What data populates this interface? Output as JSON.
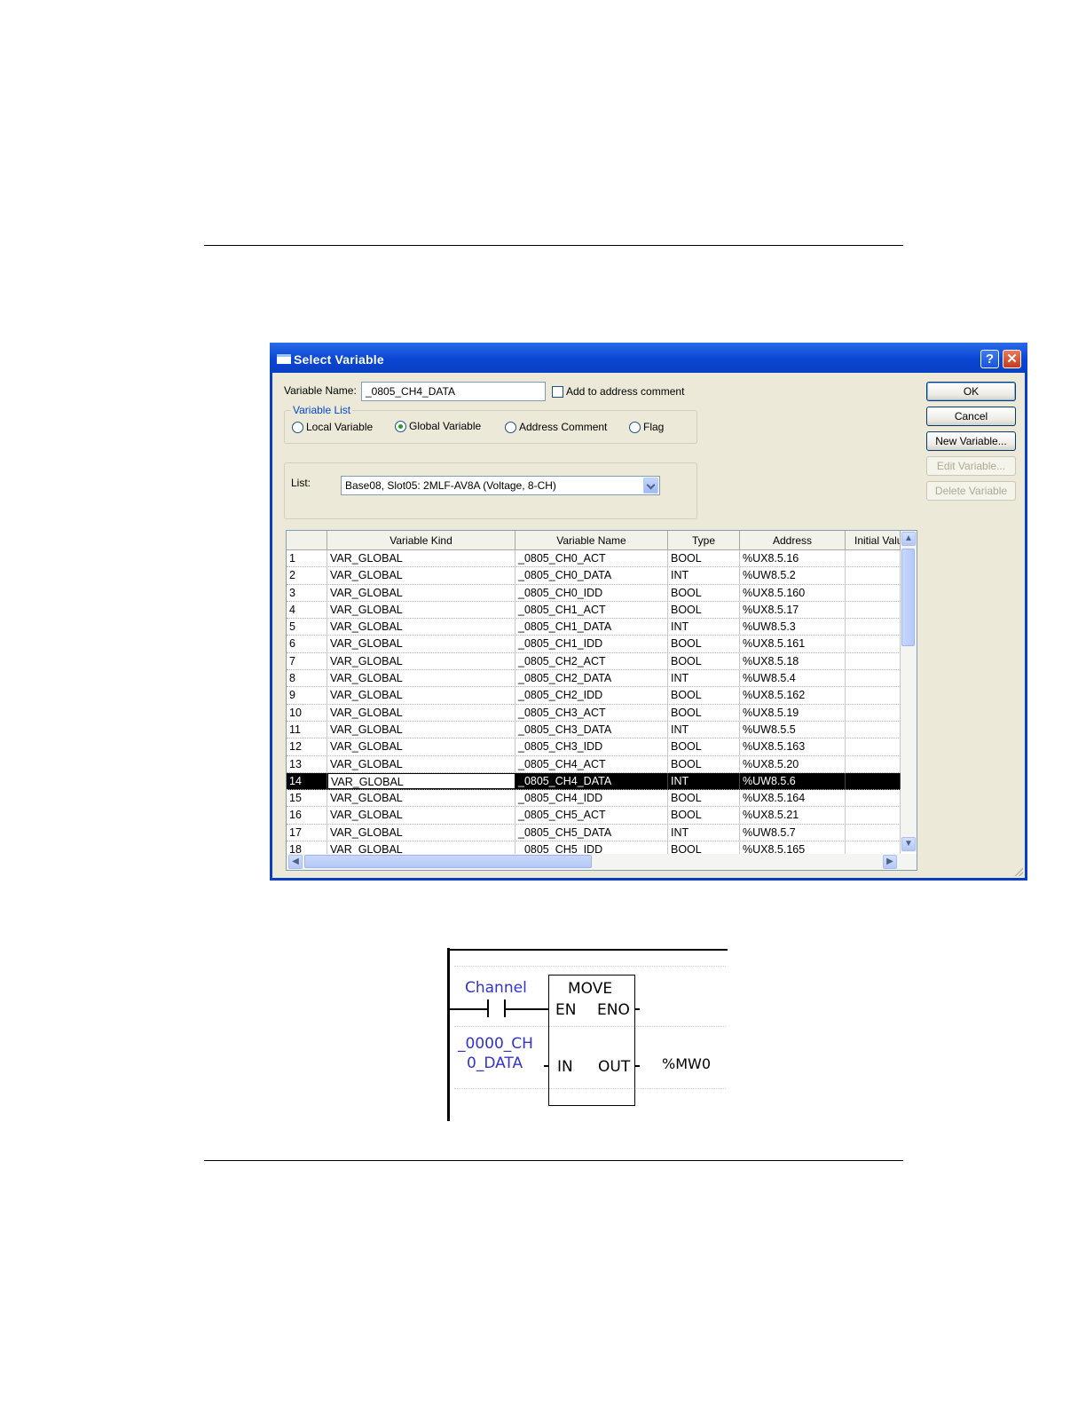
{
  "dialog": {
    "title": "Select Variable",
    "help_label": "?",
    "close_label": "✕",
    "variable_name_label": "Variable Name:",
    "variable_name_value": "_0805_CH4_DATA",
    "add_comment_label": "Add to address comment",
    "add_comment_checked": false,
    "variable_list_label": "Variable List",
    "radios": {
      "local": "Local Variable",
      "global": "Global Variable",
      "address_comment": "Address Comment",
      "flag": "Flag",
      "selected": "global"
    },
    "list_label": "List:",
    "list_value": "Base08, Slot05:  2MLF-AV8A (Voltage, 8-CH)",
    "buttons": {
      "ok": "OK",
      "cancel": "Cancel",
      "new_variable": "New Variable...",
      "edit_variable": "Edit Variable...",
      "delete_variable": "Delete Variable"
    },
    "table": {
      "columns": [
        "",
        "Variable Kind",
        "Variable Name",
        "Type",
        "Address",
        "Initial Valu"
      ],
      "selected_row": 14,
      "rows": [
        [
          "1",
          "VAR_GLOBAL",
          "_0805_CH0_ACT",
          "BOOL",
          "%UX8.5.16",
          ""
        ],
        [
          "2",
          "VAR_GLOBAL",
          "_0805_CH0_DATA",
          "INT",
          "%UW8.5.2",
          ""
        ],
        [
          "3",
          "VAR_GLOBAL",
          "_0805_CH0_IDD",
          "BOOL",
          "%UX8.5.160",
          ""
        ],
        [
          "4",
          "VAR_GLOBAL",
          "_0805_CH1_ACT",
          "BOOL",
          "%UX8.5.17",
          ""
        ],
        [
          "5",
          "VAR_GLOBAL",
          "_0805_CH1_DATA",
          "INT",
          "%UW8.5.3",
          ""
        ],
        [
          "6",
          "VAR_GLOBAL",
          "_0805_CH1_IDD",
          "BOOL",
          "%UX8.5.161",
          ""
        ],
        [
          "7",
          "VAR_GLOBAL",
          "_0805_CH2_ACT",
          "BOOL",
          "%UX8.5.18",
          ""
        ],
        [
          "8",
          "VAR_GLOBAL",
          "_0805_CH2_DATA",
          "INT",
          "%UW8.5.4",
          ""
        ],
        [
          "9",
          "VAR_GLOBAL",
          "_0805_CH2_IDD",
          "BOOL",
          "%UX8.5.162",
          ""
        ],
        [
          "10",
          "VAR_GLOBAL",
          "_0805_CH3_ACT",
          "BOOL",
          "%UX8.5.19",
          ""
        ],
        [
          "11",
          "VAR_GLOBAL",
          "_0805_CH3_DATA",
          "INT",
          "%UW8.5.5",
          ""
        ],
        [
          "12",
          "VAR_GLOBAL",
          "_0805_CH3_IDD",
          "BOOL",
          "%UX8.5.163",
          ""
        ],
        [
          "13",
          "VAR_GLOBAL",
          "_0805_CH4_ACT",
          "BOOL",
          "%UX8.5.20",
          ""
        ],
        [
          "14",
          "VAR_GLOBAL",
          "_0805_CH4_DATA",
          "INT",
          "%UW8.5.6",
          ""
        ],
        [
          "15",
          "VAR_GLOBAL",
          "_0805_CH4_IDD",
          "BOOL",
          "%UX8.5.164",
          ""
        ],
        [
          "16",
          "VAR_GLOBAL",
          "_0805_CH5_ACT",
          "BOOL",
          "%UX8.5.21",
          ""
        ],
        [
          "17",
          "VAR_GLOBAL",
          "_0805_CH5_DATA",
          "INT",
          "%UW8.5.7",
          ""
        ],
        [
          "18",
          "VAR_GLOBAL",
          "_0805_CH5_IDD",
          "BOOL",
          "%UX8.5.165",
          ""
        ]
      ]
    }
  },
  "ladder": {
    "contact_label": "Channel",
    "block_name": "MOVE",
    "en": "EN",
    "eno": "ENO",
    "in": "IN",
    "out": "OUT",
    "input_var_line1": "_0000_CH",
    "input_var_line2": "0_DATA",
    "output_var": "%MW0"
  },
  "colors": {
    "titlebar": "#0a46d4",
    "dialog_bg": "#ece9d8",
    "group_label": "#0046d5",
    "ladder_label": "#3333cc"
  }
}
